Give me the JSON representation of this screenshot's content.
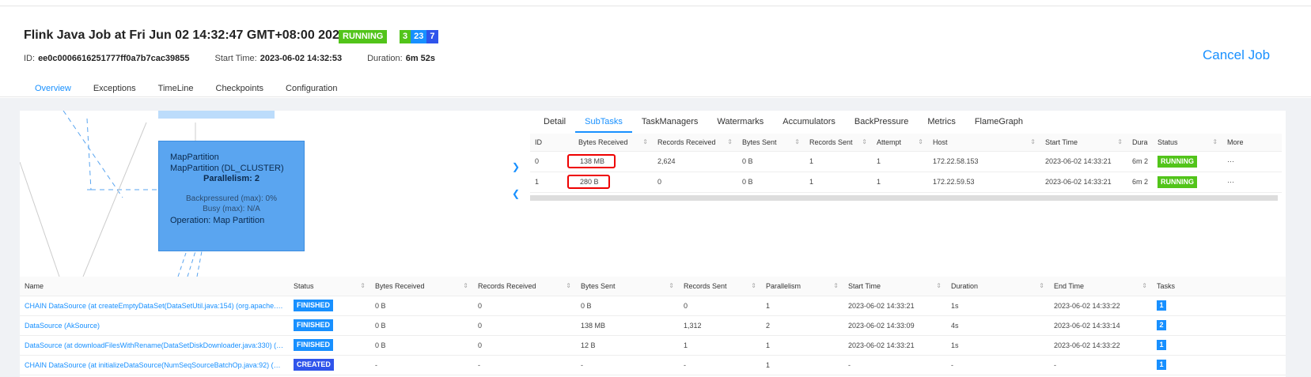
{
  "header": {
    "title": "Flink Java Job at Fri Jun 02 14:32:47 GMT+08:00 2023",
    "status": "RUNNING",
    "task_counts": [
      "3",
      "23",
      "7"
    ],
    "id_label": "ID:",
    "id_value": "ee0c0006616251777ff0a7b7cac39855",
    "start_label": "Start Time:",
    "start_value": "2023-06-02 14:32:53",
    "duration_label": "Duration:",
    "duration_value": "6m 52s",
    "cancel_label": "Cancel Job",
    "tabs": [
      "Overview",
      "Exceptions",
      "TimeLine",
      "Checkpoints",
      "Configuration"
    ]
  },
  "node": {
    "line1": "MapPartition",
    "line2": "MapPartition (DL_CLUSTER)",
    "line3": "Parallelism: 2",
    "line4": "Backpressured (max): 0%",
    "line5": "Busy (max): N/A",
    "line6": "Operation: Map Partition"
  },
  "detail": {
    "tabs": [
      "Detail",
      "SubTasks",
      "TaskManagers",
      "Watermarks",
      "Accumulators",
      "BackPressure",
      "Metrics",
      "FlameGraph"
    ],
    "columns": [
      "ID",
      "Bytes Received",
      "Records Received",
      "Bytes Sent",
      "Records Sent",
      "Attempt",
      "Host",
      "Start Time",
      "Dura",
      "Status",
      "More"
    ],
    "rows": [
      {
        "id": "0",
        "bytes_received": "138 MB",
        "records_received": "2,624",
        "bytes_sent": "0 B",
        "records_sent": "1",
        "attempt": "1",
        "host": "172.22.58.153",
        "start_time": "2023-06-02 14:33:21",
        "duration": "6m 2",
        "status": "RUNNING",
        "more": "···"
      },
      {
        "id": "1",
        "bytes_received": "280 B",
        "records_received": "0",
        "bytes_sent": "0 B",
        "records_sent": "1",
        "attempt": "1",
        "host": "172.22.59.53",
        "start_time": "2023-06-02 14:33:21",
        "duration": "6m 2",
        "status": "RUNNING",
        "more": "···"
      }
    ]
  },
  "vertices": {
    "columns": [
      "Name",
      "Status",
      "Bytes Received",
      "Records Received",
      "Bytes Sent",
      "Records Sent",
      "Parallelism",
      "Start Time",
      "Duration",
      "End Time",
      "Tasks"
    ],
    "rows": [
      {
        "name": "CHAIN DataSource (at createEmptyDataSet(DataSetUtil.java:154) (org.apache.flink.api...",
        "status": "FINISHED",
        "bytes_received": "0 B",
        "records_received": "0",
        "bytes_sent": "0 B",
        "records_sent": "0",
        "parallelism": "1",
        "start_time": "2023-06-02 14:33:21",
        "duration": "1s",
        "end_time": "2023-06-02 14:33:22",
        "tasks": "1"
      },
      {
        "name": "DataSource (AkSource)",
        "status": "FINISHED",
        "bytes_received": "0 B",
        "records_received": "0",
        "bytes_sent": "138 MB",
        "records_sent": "1,312",
        "parallelism": "2",
        "start_time": "2023-06-02 14:33:09",
        "duration": "4s",
        "end_time": "2023-06-02 14:33:14",
        "tasks": "2"
      },
      {
        "name": "DataSource (at downloadFilesWithRename(DataSetDiskDownloader.java:330) (org.apa...",
        "status": "FINISHED",
        "bytes_received": "0 B",
        "records_received": "0",
        "bytes_sent": "12 B",
        "records_sent": "1",
        "parallelism": "1",
        "start_time": "2023-06-02 14:33:21",
        "duration": "1s",
        "end_time": "2023-06-02 14:33:22",
        "tasks": "1"
      },
      {
        "name": "CHAIN DataSource (at initializeDataSource(NumSeqSourceBatchOp.java:92) (org.apac...",
        "status": "CREATED",
        "bytes_received": "-",
        "records_received": "-",
        "bytes_sent": "-",
        "records_sent": "-",
        "parallelism": "1",
        "start_time": "-",
        "duration": "-",
        "end_time": "-",
        "tasks": "1"
      }
    ]
  },
  "colors": {
    "accent": "#1890ff",
    "running": "#52c41a",
    "created": "#2f54eb",
    "highlight": "#e00000"
  }
}
